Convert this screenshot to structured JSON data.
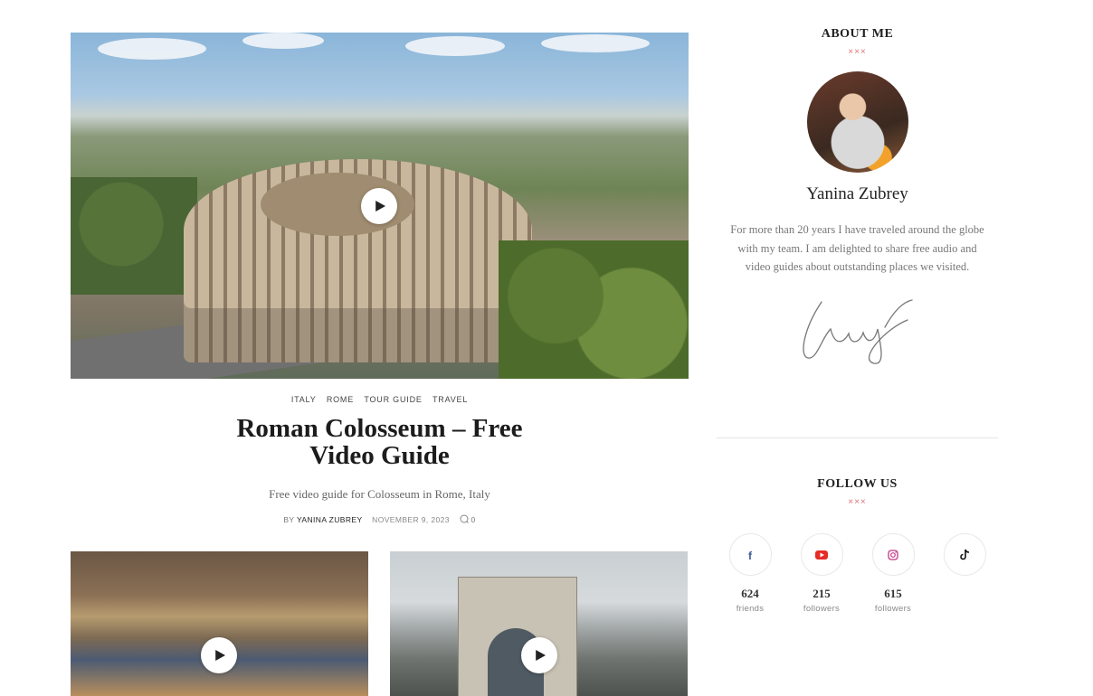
{
  "featured": {
    "categories": [
      "ITALY",
      "ROME",
      "TOUR GUIDE",
      "TRAVEL"
    ],
    "title": "Roman Colosseum – Free Video Guide",
    "excerpt": "Free video guide for Colosseum in Rome, Italy",
    "by_label": "BY",
    "author": "YANINA ZUBREY",
    "date": "NOVEMBER 9, 2023",
    "comments": "0"
  },
  "sidebar": {
    "about_title": "ABOUT ME",
    "ornament": "×××",
    "name": "Yanina Zubrey",
    "bio": "For more than 20 years I have traveled around the globe with my team. I am delighted to share free audio and video guides about outstanding places we visited.",
    "follow_title": "FOLLOW US",
    "socials": [
      {
        "icon": "facebook-icon",
        "count": "624",
        "label": "friends",
        "color": "#3b5998"
      },
      {
        "icon": "youtube-icon",
        "count": "215",
        "label": "followers",
        "color": "#e52d27"
      },
      {
        "icon": "instagram-icon",
        "count": "615",
        "label": "followers",
        "color": "#c13584"
      },
      {
        "icon": "tiktok-icon",
        "count": "",
        "label": "",
        "color": "#111111"
      }
    ]
  }
}
